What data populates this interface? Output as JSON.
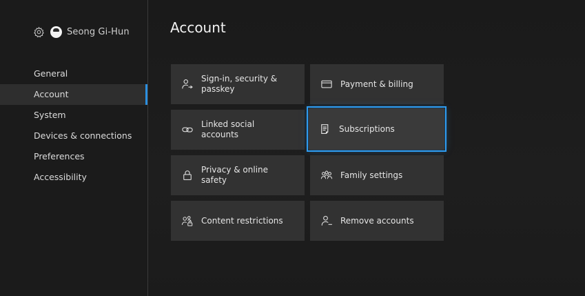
{
  "profile": {
    "name": "Seong Gi-Hun",
    "settings_icon": "gear-icon",
    "avatar": "avatar"
  },
  "nav": {
    "items": [
      {
        "label": "General",
        "active": false
      },
      {
        "label": "Account",
        "active": true
      },
      {
        "label": "System",
        "active": false
      },
      {
        "label": "Devices & connections",
        "active": false
      },
      {
        "label": "Preferences",
        "active": false
      },
      {
        "label": "Accessibility",
        "active": false
      }
    ]
  },
  "main": {
    "title": "Account",
    "tiles": [
      {
        "label": "Sign-in, security & passkey",
        "icon": "person-key-icon"
      },
      {
        "label": "Payment & billing",
        "icon": "credit-card-icon"
      },
      {
        "label": "Linked social accounts",
        "icon": "link-icon"
      },
      {
        "label": "Subscriptions",
        "icon": "subscriptions-icon",
        "focused": true
      },
      {
        "label": "Privacy & online safety",
        "icon": "lock-icon"
      },
      {
        "label": "Family settings",
        "icon": "family-icon"
      },
      {
        "label": "Content restrictions",
        "icon": "people-lock-icon"
      },
      {
        "label": "Remove accounts",
        "icon": "person-remove-icon"
      }
    ]
  },
  "colors": {
    "accent": "#2f9cf0",
    "tile": "#323232",
    "background": "#1c1c1c"
  }
}
